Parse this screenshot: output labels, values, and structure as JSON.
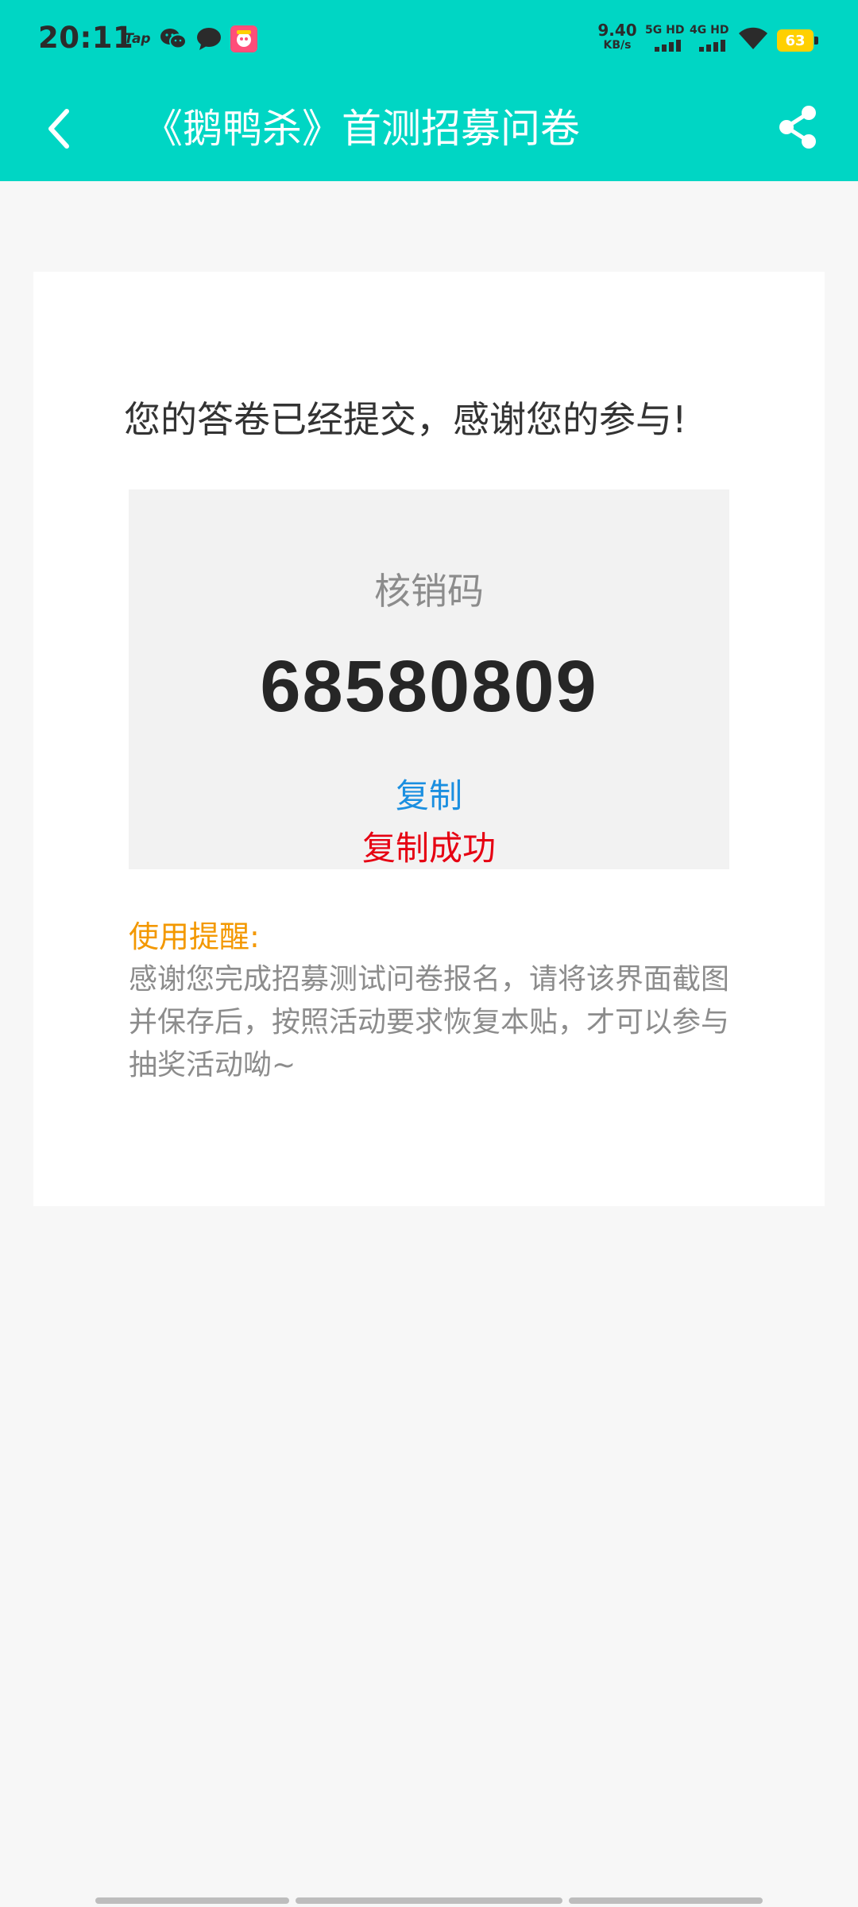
{
  "status_bar": {
    "time": "20:11",
    "notif_tap": "Tap",
    "net_speed_value": "9.40",
    "net_speed_unit": "KB/s",
    "sim1_label": "5G HD",
    "sim2_label": "4G HD",
    "battery": "63",
    "battery_color": "#ffd000"
  },
  "header": {
    "title": "《鹅鸭杀》首测招募问卷",
    "back_icon": "chevron-left-icon",
    "share_icon": "share-icon",
    "bg_color": "#00d6c4"
  },
  "card": {
    "thanks": "您的答卷已经提交，感谢您的参与!",
    "code_label": "核销码",
    "code_value": "68580809",
    "copy_label": "复制",
    "copy_status": "复制成功",
    "reminder_title": "使用提醒:",
    "reminder_body": "感谢您完成招募测试问卷报名，请将该界面截图并保存后，按照活动要求恢复本贴，才可以参与抽奖活动呦~"
  },
  "colors": {
    "copy_link": "#1b8fe0",
    "copy_success": "#e60012",
    "reminder_title": "#f39800"
  }
}
